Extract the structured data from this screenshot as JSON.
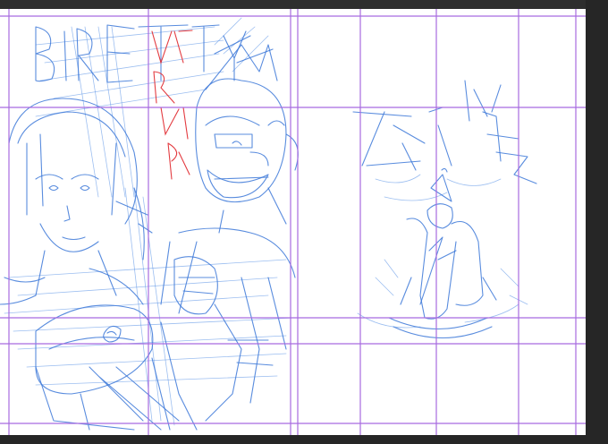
{
  "app": {
    "view": "sketch-canvas",
    "layers": [
      "blue-sketch-layer",
      "red-text-layer",
      "panel-guides"
    ]
  },
  "colors": {
    "workspace": "#2e2e2e",
    "paper": "#ffffff",
    "guide": "#a86be0",
    "sketch_blue": "#3c78d8",
    "sketch_red": "#e0262b"
  }
}
